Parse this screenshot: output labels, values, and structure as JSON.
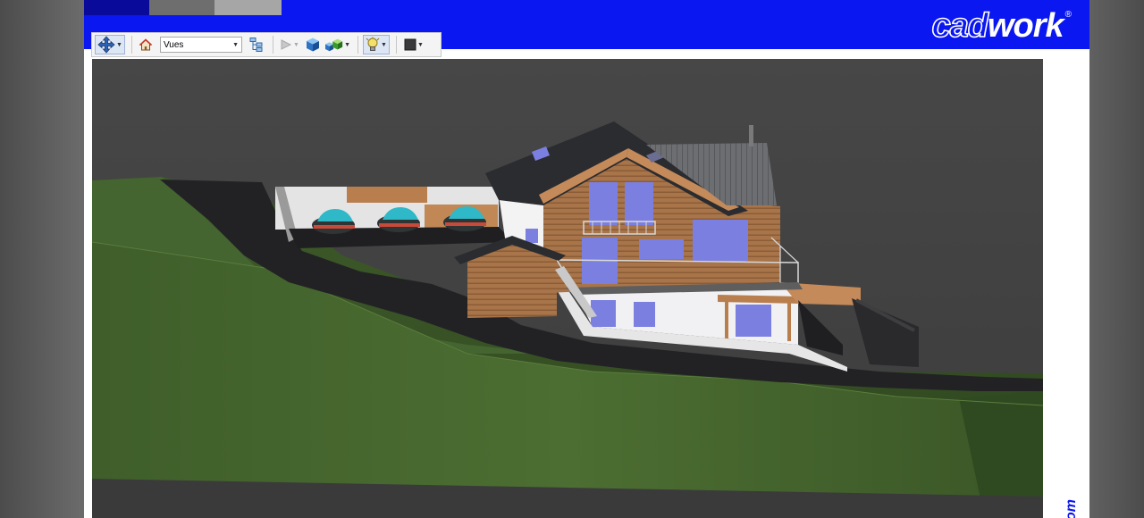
{
  "header": {
    "tabs": [
      {
        "color": "#0a0a9a"
      },
      {
        "color": "#6e6e6e"
      },
      {
        "color": "#a6a6a6"
      }
    ],
    "brand_outline": "cad",
    "brand_solid": "work",
    "brand_reg": "®",
    "brand_color": "#0a17f0"
  },
  "toolbar": {
    "navigate_icon": "move-arrows-icon",
    "home_icon": "home-icon",
    "views_value": "Vues",
    "tree_icon": "tree-structure-icon",
    "play_icon": "play-icon",
    "cube_icon": "cube-icon",
    "cubes_icon": "cubes-icon",
    "light_icon": "light-bulb-icon",
    "color_icon": "color-square-icon"
  },
  "side_text": "om"
}
